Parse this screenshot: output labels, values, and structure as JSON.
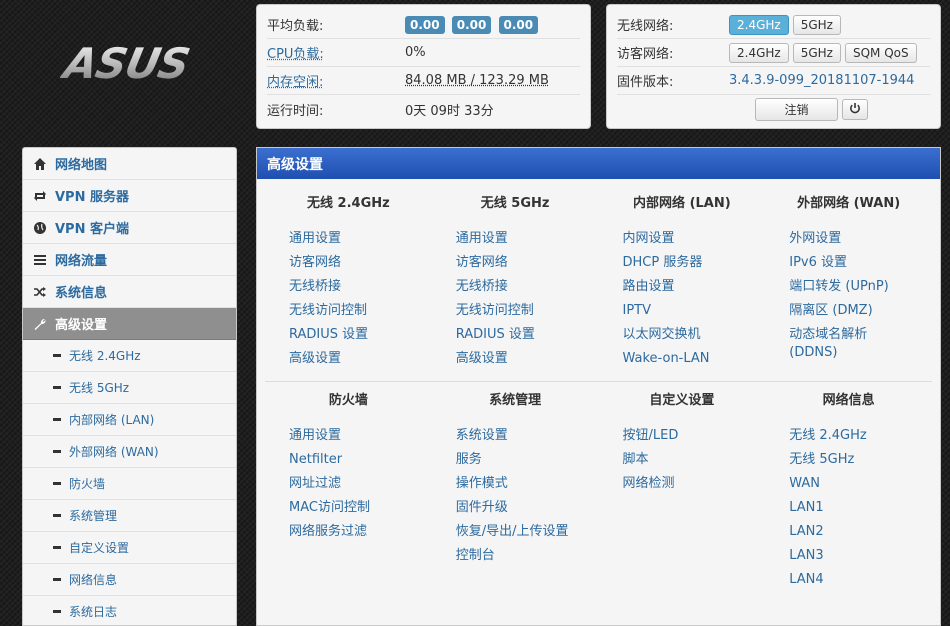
{
  "brand": "ASUS",
  "status": {
    "load_label": "平均负载:",
    "load_values": [
      "0.00",
      "0.00",
      "0.00"
    ],
    "cpu_label": "CPU负载:",
    "cpu_value": "0%",
    "mem_label": "内存空闲:",
    "mem_value": "84.08 MB / 123.29 MB",
    "uptime_label": "运行时间:",
    "uptime_value": "0天 09时 33分"
  },
  "wifi": {
    "wireless_label": "无线网络:",
    "wireless_buttons": [
      "2.4GHz",
      "5GHz"
    ],
    "guest_label": "访客网络:",
    "guest_buttons": [
      "2.4GHz",
      "5GHz",
      "SQM QoS"
    ],
    "firmware_label": "固件版本:",
    "firmware_value": "3.4.3.9-099_20181107-1944",
    "logout_label": "注销"
  },
  "sidebar": {
    "items": [
      {
        "label": "网络地图",
        "icon": "home-icon"
      },
      {
        "label": "VPN 服务器",
        "icon": "retweet-icon"
      },
      {
        "label": "VPN 客户端",
        "icon": "globe-icon"
      },
      {
        "label": "网络流量",
        "icon": "list-icon"
      },
      {
        "label": "系统信息",
        "icon": "random-icon"
      },
      {
        "label": "高级设置",
        "icon": "wrench-icon"
      }
    ],
    "subitems": [
      "无线 2.4GHz",
      "无线 5GHz",
      "内部网络 (LAN)",
      "外部网络 (WAN)",
      "防火墙",
      "系统管理",
      "自定义设置",
      "网络信息",
      "系统日志"
    ]
  },
  "main": {
    "title": "高级设置",
    "sections": [
      {
        "columns": [
          {
            "heading": "无线 2.4GHz",
            "links": [
              "通用设置",
              "访客网络",
              "无线桥接",
              "无线访问控制",
              "RADIUS 设置",
              "高级设置"
            ]
          },
          {
            "heading": "无线 5GHz",
            "links": [
              "通用设置",
              "访客网络",
              "无线桥接",
              "无线访问控制",
              "RADIUS 设置",
              "高级设置"
            ]
          },
          {
            "heading": "内部网络 (LAN)",
            "links": [
              "内网设置",
              "DHCP 服务器",
              "路由设置",
              "IPTV",
              "以太网交换机",
              "Wake-on-LAN"
            ]
          },
          {
            "heading": "外部网络 (WAN)",
            "links": [
              "外网设置",
              "IPv6 设置",
              "端口转发 (UPnP)",
              "隔离区 (DMZ)",
              "动态域名解析 (DDNS)"
            ]
          }
        ]
      },
      {
        "columns": [
          {
            "heading": "防火墙",
            "links": [
              "通用设置",
              "Netfilter",
              "网址过滤",
              "MAC访问控制",
              "网络服务过滤"
            ]
          },
          {
            "heading": "系统管理",
            "links": [
              "系统设置",
              "服务",
              "操作模式",
              "固件升级",
              "恢复/导出/上传设置",
              "控制台"
            ]
          },
          {
            "heading": "自定义设置",
            "links": [
              "按钮/LED",
              "脚本",
              "网络检测"
            ]
          },
          {
            "heading": "网络信息",
            "links": [
              "无线 2.4GHz",
              "无线 5GHz",
              "WAN",
              "LAN1",
              "LAN2",
              "LAN3",
              "LAN4"
            ]
          }
        ]
      }
    ]
  }
}
